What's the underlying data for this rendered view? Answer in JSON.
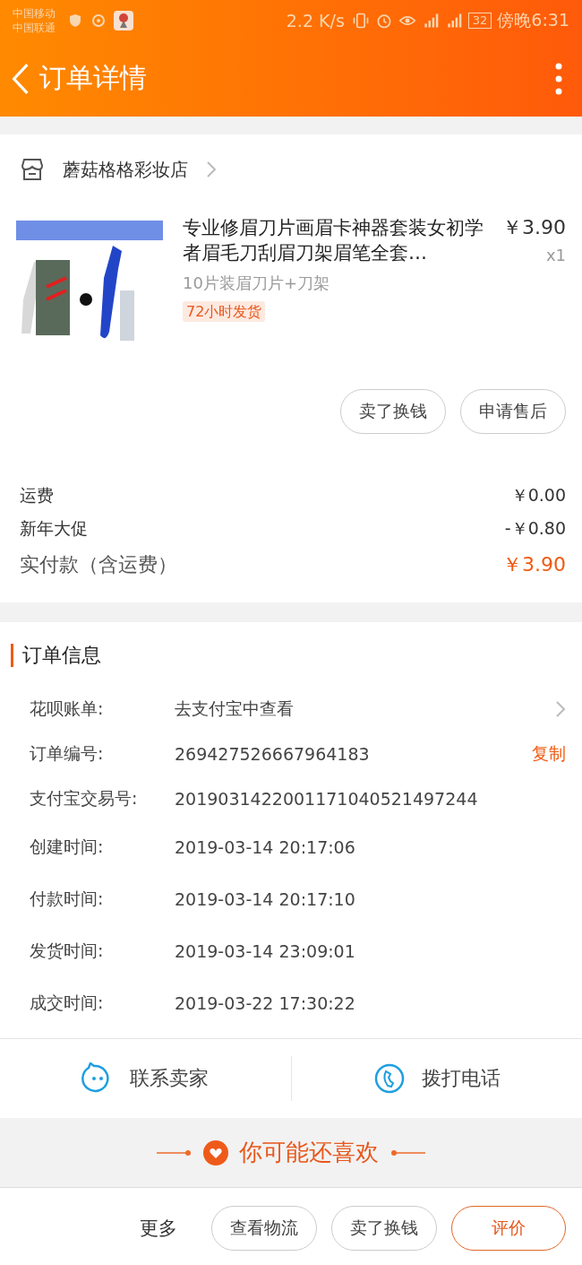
{
  "status_bar": {
    "carriers": [
      "中国移动",
      "中国联通"
    ],
    "speed": "2.2 K/s",
    "battery": "32",
    "time": "傍晚6:31"
  },
  "header": {
    "title": "订单详情"
  },
  "shop": {
    "name": "蘑菇格格彩妆店"
  },
  "product": {
    "title": "专业修眉刀片画眉卡神器套装女初学者眉毛刀刮眉刀架眉笔全套…",
    "price": "￥3.90",
    "quantity": "x1",
    "variant": "10片装眉刀片+刀架",
    "tag": "72小时发货"
  },
  "item_actions": [
    "卖了换钱",
    "申请售后"
  ],
  "fees": [
    {
      "label": "运费",
      "value": "￥0.00",
      "kind": "normal"
    },
    {
      "label": "新年大促",
      "value": "-￥0.80",
      "kind": "normal"
    },
    {
      "label": "实付款（含运费）",
      "value": "￥3.90",
      "kind": "total"
    }
  ],
  "order_info": {
    "title": "订单信息",
    "rows": [
      {
        "label": "花呗账单:",
        "value": "去支付宝中查看",
        "kind": "link"
      },
      {
        "label": "订单编号:",
        "value": "269427526667964183",
        "action": "复制",
        "kind": "copy"
      },
      {
        "label": "支付宝交易号:",
        "value": "2019031422001171040521497244",
        "kind": "plain"
      },
      {
        "label": "创建时间:",
        "value": "2019-03-14 20:17:06",
        "kind": "plain"
      },
      {
        "label": "付款时间:",
        "value": "2019-03-14 20:17:10",
        "kind": "plain"
      },
      {
        "label": "发货时间:",
        "value": "2019-03-14 23:09:01",
        "kind": "plain"
      },
      {
        "label": "成交时间:",
        "value": "2019-03-22 17:30:22",
        "kind": "plain"
      }
    ]
  },
  "contact": [
    {
      "label": "联系卖家",
      "kind": "chat"
    },
    {
      "label": "拨打电话",
      "kind": "phone"
    }
  ],
  "recommend": {
    "title": "你可能还喜欢"
  },
  "bottom_bar": {
    "more": "更多",
    "buttons": [
      {
        "label": "查看物流",
        "primary": false
      },
      {
        "label": "卖了换钱",
        "primary": false
      },
      {
        "label": "评价",
        "primary": true
      }
    ]
  }
}
